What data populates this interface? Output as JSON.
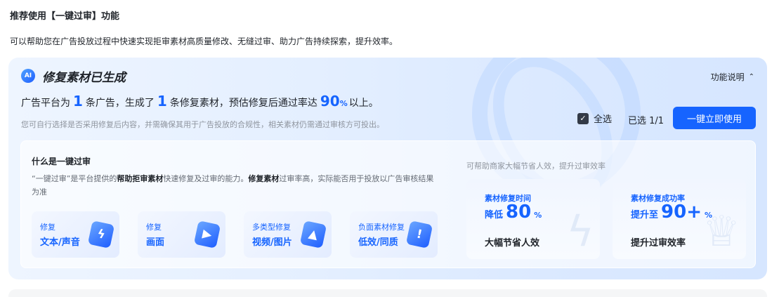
{
  "page": {
    "title": "推荐使用【一键过审】功能",
    "description": "可以帮助您在广告投放过程中快速实现拒审素材高质量修改、无缝过审、助力广告持续探索，提升效率。"
  },
  "card": {
    "badge": "AI",
    "title": "修复素材已生成",
    "feature_link": "功能说明",
    "summary": {
      "p1": "广告平台为",
      "ads_count": "1",
      "p2": "条广告，生成了",
      "material_count": "1",
      "p3": "条修复素材，预估修复后通过率达",
      "pass_rate": "90",
      "pct": "%",
      "p4": "以上。"
    },
    "note": "您可自行选择是否采用修复后内容，并需确保其用于广告投放的合规性，相关素材仍需通过审核方可投出。",
    "select_all_label": "全选",
    "selected_count": "已选 1/1",
    "apply_button": "一键立即使用"
  },
  "intro": {
    "title": "什么是一键过审",
    "desc_q": "“一键过审”是平台提供的",
    "desc_b1": "帮助拒审素材",
    "desc_m1": "快速修复及过审的能力。",
    "desc_b2": "修复素材",
    "desc_m2": "过审率高，实际能否用于投放以广告审核结果为准",
    "tiles": [
      {
        "line1": "修复",
        "line2": "文本/声音",
        "icon": "lightning-icon"
      },
      {
        "line1": "修复",
        "line2": "画面",
        "icon": "play-icon"
      },
      {
        "line1": "多类型修复",
        "line2": "视频/图片",
        "icon": "image-icon"
      },
      {
        "line1": "负面素材修复",
        "line2": "低效/同质",
        "icon": "alert-icon"
      }
    ]
  },
  "benefits": {
    "hint": "可帮助商家大幅节省人效，提升过审效率",
    "stats": [
      {
        "label": "素材修复时间",
        "prefix": "降低",
        "value": "80",
        "suffix": "%",
        "foot": "大幅节省人效"
      },
      {
        "label": "素材修复成功率",
        "prefix": "提升至",
        "value": "90+",
        "suffix": "%",
        "foot": "提升过审效率"
      }
    ]
  },
  "colors": {
    "accent": "#1664ff",
    "text": "#1f2329",
    "muted": "#8f959e"
  }
}
